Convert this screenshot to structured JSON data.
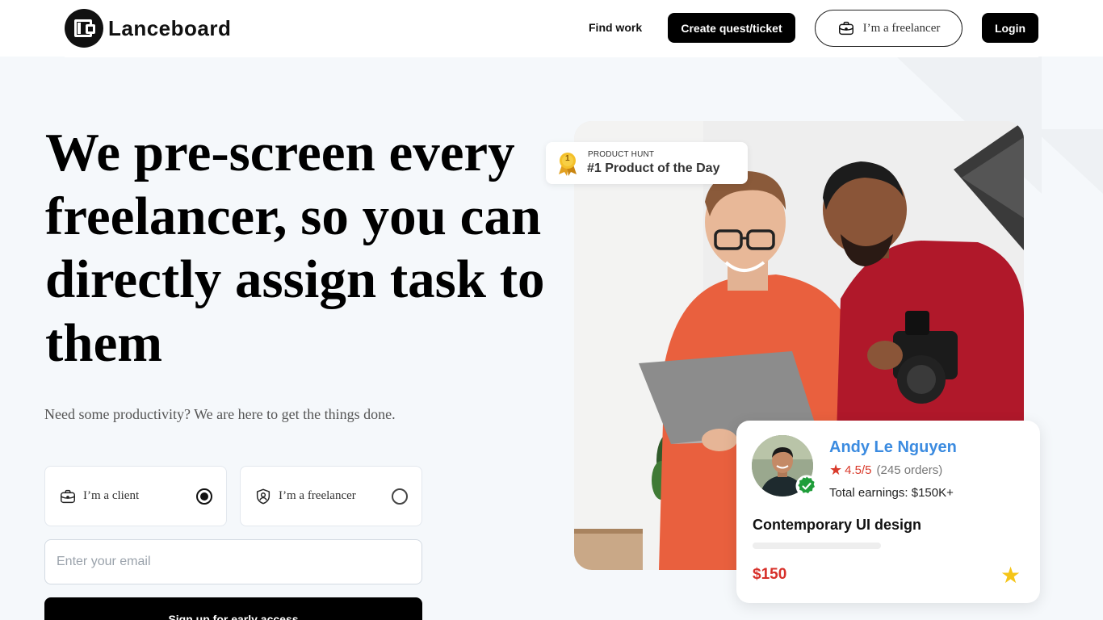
{
  "header": {
    "brand": "Lanceboard",
    "nav_find_work": "Find work",
    "create_button": "Create quest/ticket",
    "freelancer_button": "I’m a freelancer",
    "login_button": "Login"
  },
  "hero": {
    "headline": "We pre-screen every freelancer, so you can directly assign task to them",
    "subtext": "Need some productivity? We are here to get the things done.",
    "roles": [
      {
        "label": "I’m a client",
        "icon": "briefcase-icon",
        "selected": true
      },
      {
        "label": "I’m a freelancer",
        "icon": "user-badge-icon",
        "selected": false
      }
    ],
    "email_placeholder": "Enter your email",
    "signup_button": "Sign up for early access"
  },
  "product_hunt": {
    "medal_number": "1",
    "label": "PRODUCT HUNT",
    "title": "#1 Product of the Day"
  },
  "profile_card": {
    "name": "Andy Le Nguyen",
    "rating": "4.5/5",
    "orders": "(245 orders)",
    "earnings": "Total earnings: $150K+",
    "gig_title": "Contemporary UI design",
    "price": "$150"
  },
  "colors": {
    "accent_blue": "#3b8be0",
    "price_red": "#d7302a",
    "star_yellow": "#f5c518",
    "verified_green": "#1f9d3a"
  }
}
